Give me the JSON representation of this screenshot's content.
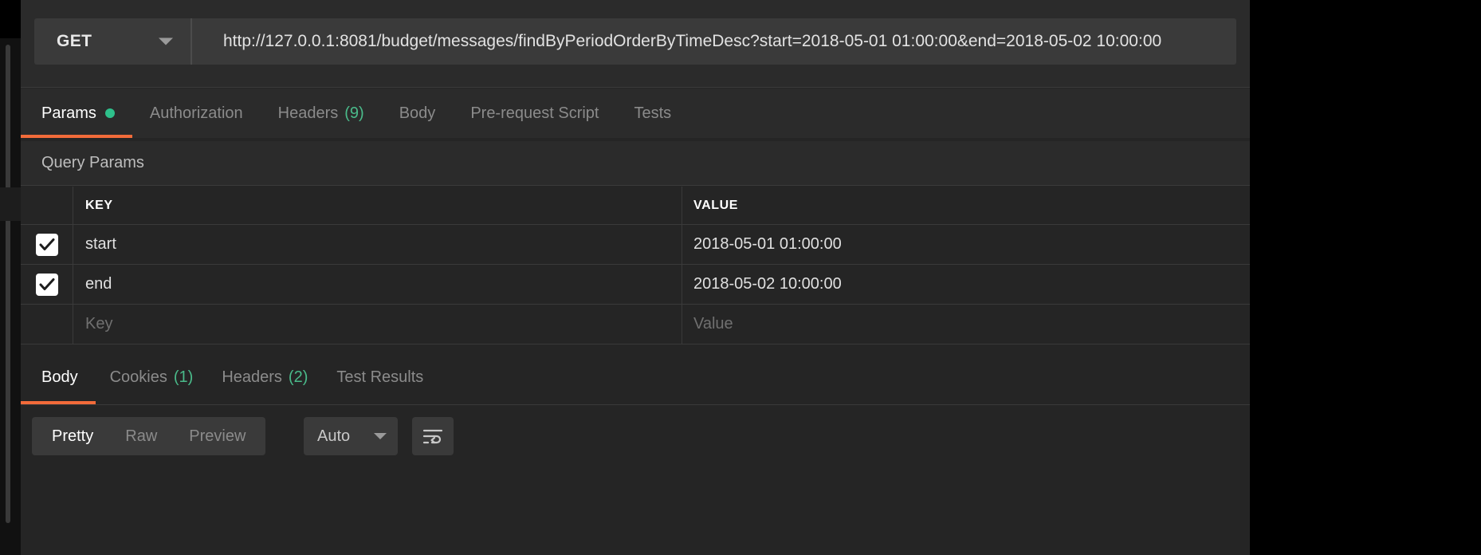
{
  "request": {
    "method": "GET",
    "url": "http://127.0.0.1:8081/budget/messages/findByPeriodOrderByTimeDesc?start=2018-05-01 01:00:00&end=2018-05-02 10:00:00",
    "tabs": [
      {
        "label": "Params",
        "count": "",
        "dot": true,
        "active": true
      },
      {
        "label": "Authorization",
        "count": "",
        "dot": false,
        "active": false
      },
      {
        "label": "Headers",
        "count": "(9)",
        "dot": false,
        "active": false
      },
      {
        "label": "Body",
        "count": "",
        "dot": false,
        "active": false
      },
      {
        "label": "Pre-request Script",
        "count": "",
        "dot": false,
        "active": false
      },
      {
        "label": "Tests",
        "count": "",
        "dot": false,
        "active": false
      }
    ]
  },
  "query_params": {
    "section_title": "Query Params",
    "columns": {
      "key": "KEY",
      "value": "VALUE"
    },
    "rows": [
      {
        "checked": true,
        "key": "start",
        "value": "2018-05-01 01:00:00"
      },
      {
        "checked": true,
        "key": "end",
        "value": "2018-05-02 10:00:00"
      }
    ],
    "placeholder_row": {
      "key": "Key",
      "value": "Value"
    }
  },
  "response": {
    "tabs": [
      {
        "label": "Body",
        "count": "",
        "active": true
      },
      {
        "label": "Cookies",
        "count": "(1)",
        "active": false
      },
      {
        "label": "Headers",
        "count": "(2)",
        "active": false
      },
      {
        "label": "Test Results",
        "count": "",
        "active": false
      }
    ],
    "view_modes": [
      {
        "label": "Pretty",
        "active": true
      },
      {
        "label": "Raw",
        "active": false
      },
      {
        "label": "Preview",
        "active": false
      }
    ],
    "format_selected": "Auto"
  },
  "colors": {
    "accent_orange": "#f26b3a",
    "accent_green": "#2ec08b",
    "count_green": "#4aba8a",
    "panel_bg": "#252525",
    "bar_bg": "#2b2b2b",
    "field_bg": "#3a3a3a"
  },
  "icons": {
    "method_caret": "chevron-down-icon",
    "format_caret": "chevron-down-icon",
    "wrap": "word-wrap-icon",
    "checkmark": "check-icon",
    "unsaved_dot": "unsaved-dot-icon"
  }
}
